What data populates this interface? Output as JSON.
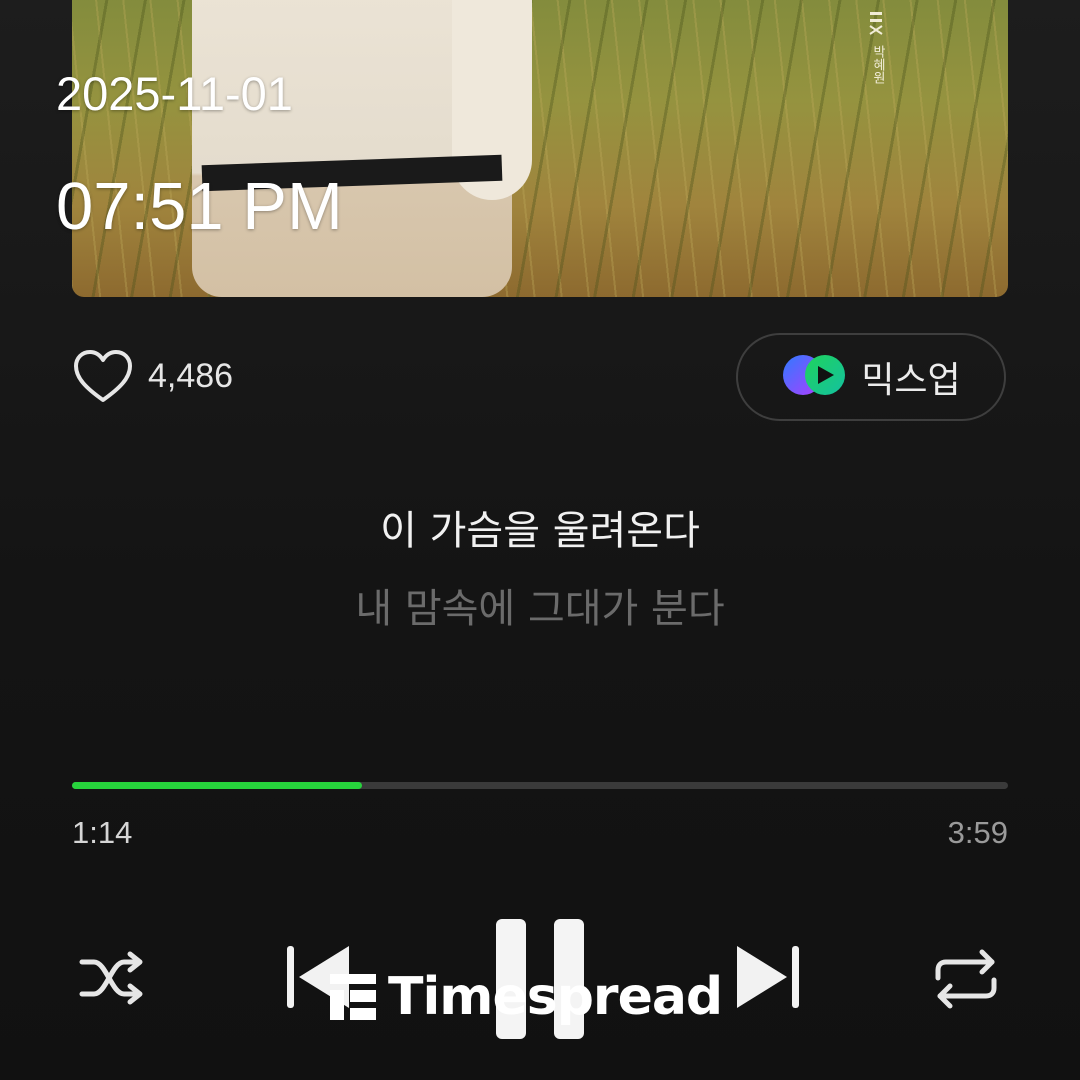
{
  "status": {
    "date": "2025-11-01",
    "time": "07:51 PM"
  },
  "album": {
    "side_text": "박혜원"
  },
  "like": {
    "count": "4,486",
    "icon": "heart-outline-icon"
  },
  "mixup": {
    "label": "믹스업",
    "icon": "mixup-icon"
  },
  "lyrics": {
    "current": "이 가슴을 울려온다",
    "next": "내 맘속에 그대가 분다"
  },
  "progress": {
    "elapsed": "1:14",
    "total": "3:59",
    "fraction": 0.31
  },
  "controls": {
    "shuffle_icon": "shuffle-icon",
    "prev_icon": "skip-previous-icon",
    "pause_icon": "pause-icon",
    "next_icon": "skip-next-icon",
    "repeat_icon": "repeat-icon"
  },
  "watermark": {
    "text": "Timespread"
  },
  "colors": {
    "accent": "#27d33c",
    "background": "#151515",
    "lyric_dim": "#6b6b6b"
  }
}
